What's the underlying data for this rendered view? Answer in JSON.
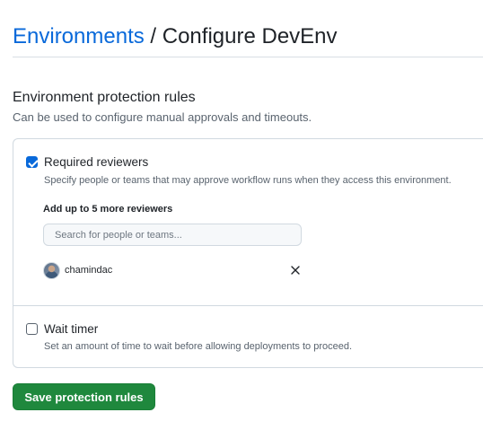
{
  "header": {
    "breadcrumb_link": "Environments",
    "separator": " / ",
    "current": "Configure DevEnv"
  },
  "section": {
    "title": "Environment protection rules",
    "description": "Can be used to configure manual approvals and timeouts."
  },
  "required_reviewers": {
    "checked": true,
    "label": "Required reviewers",
    "description": "Specify people or teams that may approve workflow runs when they access this environment.",
    "add_label": "Add up to 5 more reviewers",
    "search_placeholder": "Search for people or teams...",
    "reviewers": [
      {
        "name": "chamindac"
      }
    ]
  },
  "wait_timer": {
    "checked": false,
    "label": "Wait timer",
    "description": "Set an amount of time to wait before allowing deployments to proceed."
  },
  "save_button": "Save protection rules",
  "colors": {
    "link": "#0969da",
    "checkbox_checked": "#0969da",
    "primary_button": "#1f883d",
    "muted_text": "#59636e",
    "border": "#d1d9e0"
  },
  "icons": {
    "remove": "x-icon",
    "checkbox": "checkmark-icon"
  }
}
